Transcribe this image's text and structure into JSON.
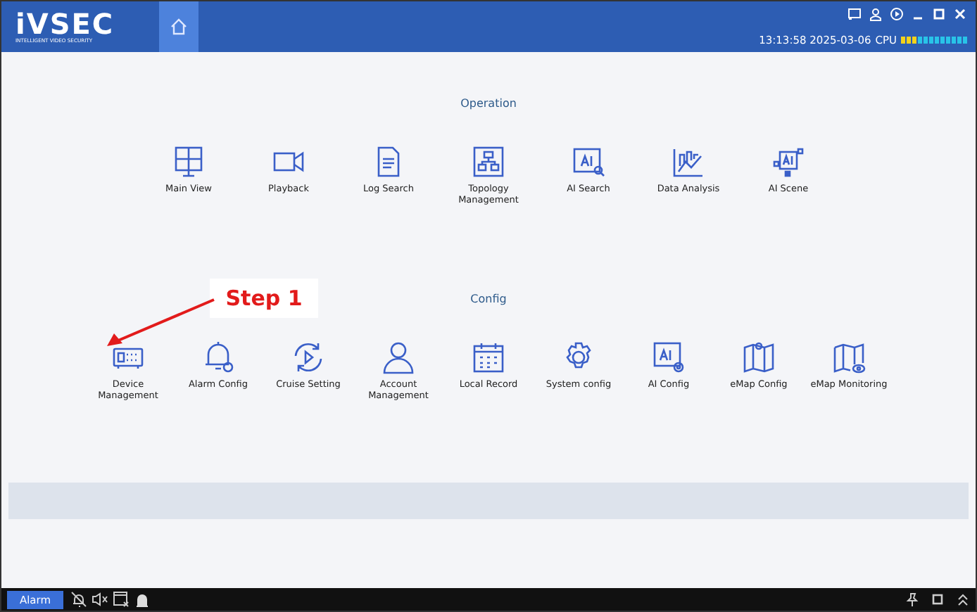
{
  "header": {
    "logo": "iVSEC",
    "tagline": "INTELLIGENT VIDEO SECURITY",
    "clock": "13:13:58 2025-03-06",
    "cpu_label": "CPU",
    "cpu": {
      "level": 0.25
    }
  },
  "sections": [
    {
      "title": "Operation",
      "items": [
        {
          "kind": "monitor",
          "label": "Main View"
        },
        {
          "kind": "camera",
          "label": "Playback"
        },
        {
          "kind": "document",
          "label": "Log Search"
        },
        {
          "kind": "topology",
          "label": "Topology Management"
        },
        {
          "kind": "ai-search",
          "label": "AI Search"
        },
        {
          "kind": "chart",
          "label": "Data Analysis"
        },
        {
          "kind": "ai-scene",
          "label": "AI Scene"
        }
      ]
    },
    {
      "title": "Config",
      "items": [
        {
          "kind": "device",
          "label": "Device Management"
        },
        {
          "kind": "bell",
          "label": "Alarm Config"
        },
        {
          "kind": "cycle",
          "label": "Cruise Setting"
        },
        {
          "kind": "person",
          "label": "Account Management"
        },
        {
          "kind": "calendar",
          "label": "Local Record"
        },
        {
          "kind": "gear",
          "label": "System config"
        },
        {
          "kind": "ai-gear",
          "label": "AI Config"
        },
        {
          "kind": "map",
          "label": "eMap Config"
        },
        {
          "kind": "map-eye",
          "label": "eMap Monitoring"
        }
      ]
    }
  ],
  "annotation": {
    "text": "Step 1"
  },
  "footer": {
    "alarm_button": "Alarm"
  }
}
